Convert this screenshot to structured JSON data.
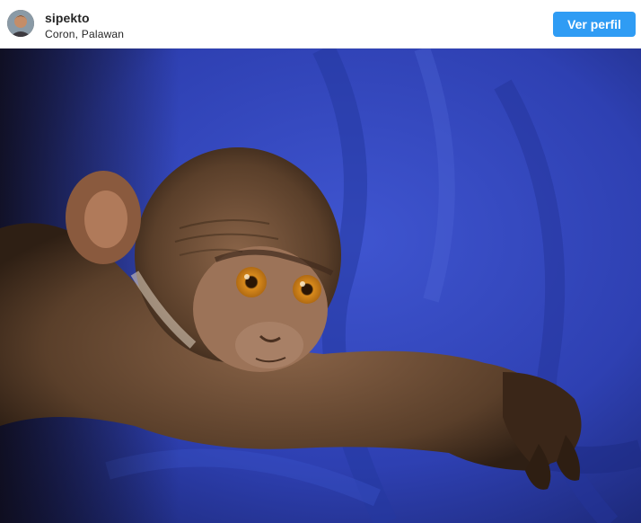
{
  "post": {
    "user": {
      "name": "sipekto",
      "location": "Coron, Palawan"
    },
    "profile_button_label": "Ver perfil",
    "photo": {
      "subject": "baby-monkey-on-blue-fabric"
    }
  },
  "colors": {
    "accent": "#2f9cf4",
    "text": "#262626",
    "fabric_blue": "#2f3fb0",
    "fur_brown": "#5a3f2a"
  }
}
